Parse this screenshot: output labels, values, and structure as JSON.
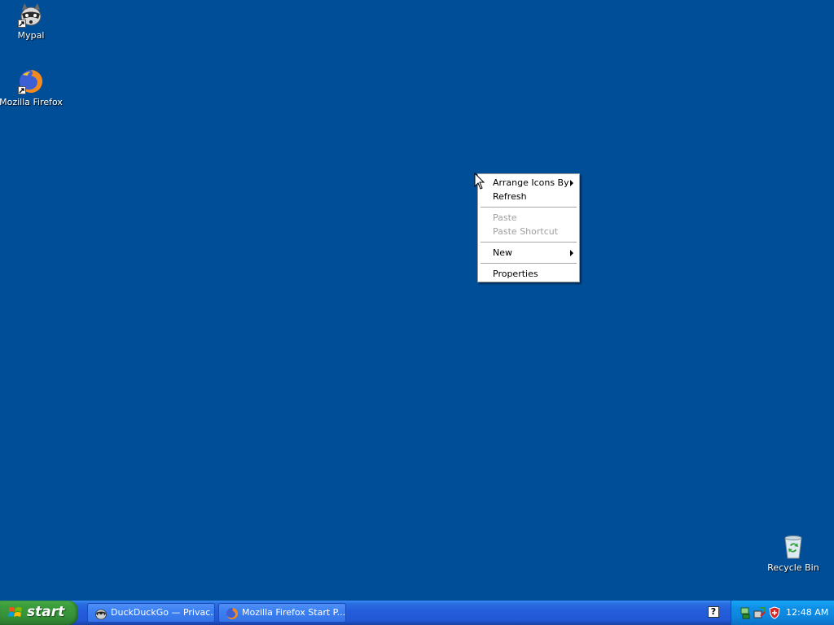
{
  "desktop": {
    "icons": [
      {
        "label": "Mypal",
        "icon": "raccoon-icon"
      },
      {
        "label": "Mozilla Firefox",
        "icon": "firefox-icon"
      },
      {
        "label": "Recycle Bin",
        "icon": "recycle-bin-icon"
      }
    ],
    "background_color": "#004e98"
  },
  "context_menu": {
    "items": [
      {
        "label": "Arrange Icons By",
        "enabled": true,
        "submenu": true
      },
      {
        "label": "Refresh",
        "enabled": true,
        "submenu": false
      },
      {
        "label": "Paste",
        "enabled": false,
        "submenu": false
      },
      {
        "label": "Paste Shortcut",
        "enabled": false,
        "submenu": false
      },
      {
        "label": "New",
        "enabled": true,
        "submenu": true
      },
      {
        "label": "Properties",
        "enabled": true,
        "submenu": false
      }
    ]
  },
  "taskbar": {
    "start_label": "start",
    "tasks": [
      {
        "label": "DuckDuckGo — Privac...",
        "icon": "raccoon-icon"
      },
      {
        "label": "Mozilla Firefox Start P...",
        "icon": "firefox-icon"
      }
    ],
    "clock": "12:48 AM",
    "tray_icons": [
      "network-icon",
      "safely-remove-icon",
      "security-shield-icon"
    ],
    "help_glyph": "?"
  },
  "colors": {
    "taskbar_blue": "#245edb",
    "start_green": "#3c9e3c",
    "tray_blue": "#0f8fe6"
  }
}
